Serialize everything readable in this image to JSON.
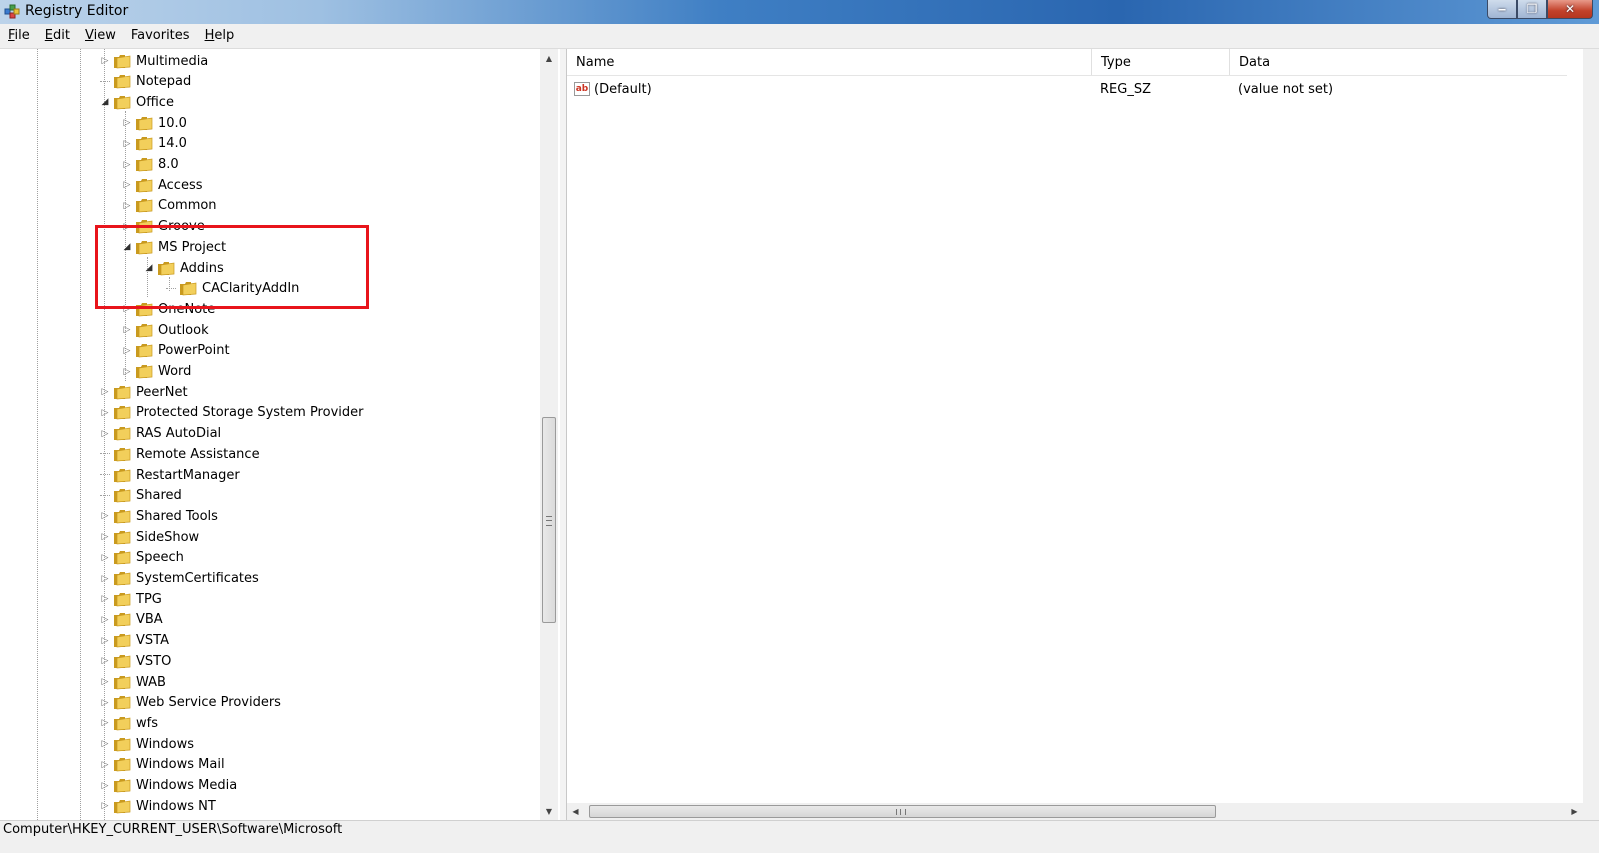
{
  "window": {
    "title": "Registry Editor",
    "controls": {
      "minimize": "‒",
      "restore": "❐",
      "close": "✕"
    }
  },
  "menu": {
    "items": [
      {
        "label": "File",
        "key": "F",
        "rest": "ile"
      },
      {
        "label": "Edit",
        "key": "E",
        "rest": "dit"
      },
      {
        "label": "View",
        "key": "V",
        "rest": "iew"
      },
      {
        "label": "Favorites",
        "key": "",
        "rest": "Favorites",
        "mid_key": "a"
      },
      {
        "label": "Help",
        "key": "H",
        "rest": "elp"
      }
    ]
  },
  "tree": {
    "nodes": [
      {
        "label": "Multimedia",
        "level": 0,
        "expander": "collapsed"
      },
      {
        "label": "Notepad",
        "level": 0,
        "expander": "none"
      },
      {
        "label": "Office",
        "level": 0,
        "expander": "expanded"
      },
      {
        "label": "10.0",
        "level": 1,
        "expander": "collapsed"
      },
      {
        "label": "14.0",
        "level": 1,
        "expander": "collapsed"
      },
      {
        "label": "8.0",
        "level": 1,
        "expander": "collapsed"
      },
      {
        "label": "Access",
        "level": 1,
        "expander": "collapsed"
      },
      {
        "label": "Common",
        "level": 1,
        "expander": "collapsed"
      },
      {
        "label": "Groove",
        "level": 1,
        "expander": "collapsed"
      },
      {
        "label": "MS Project",
        "level": 1,
        "expander": "expanded"
      },
      {
        "label": "Addins",
        "level": 2,
        "expander": "expanded"
      },
      {
        "label": "CAClarityAddIn",
        "level": 3,
        "expander": "none"
      },
      {
        "label": "OneNote",
        "level": 1,
        "expander": "collapsed"
      },
      {
        "label": "Outlook",
        "level": 1,
        "expander": "collapsed"
      },
      {
        "label": "PowerPoint",
        "level": 1,
        "expander": "collapsed"
      },
      {
        "label": "Word",
        "level": 1,
        "expander": "collapsed"
      },
      {
        "label": "PeerNet",
        "level": 0,
        "expander": "collapsed"
      },
      {
        "label": "Protected Storage System Provider",
        "level": 0,
        "expander": "collapsed"
      },
      {
        "label": "RAS AutoDial",
        "level": 0,
        "expander": "collapsed"
      },
      {
        "label": "Remote Assistance",
        "level": 0,
        "expander": "none"
      },
      {
        "label": "RestartManager",
        "level": 0,
        "expander": "none"
      },
      {
        "label": "Shared",
        "level": 0,
        "expander": "none"
      },
      {
        "label": "Shared Tools",
        "level": 0,
        "expander": "collapsed"
      },
      {
        "label": "SideShow",
        "level": 0,
        "expander": "collapsed"
      },
      {
        "label": "Speech",
        "level": 0,
        "expander": "collapsed"
      },
      {
        "label": "SystemCertificates",
        "level": 0,
        "expander": "collapsed"
      },
      {
        "label": "TPG",
        "level": 0,
        "expander": "collapsed"
      },
      {
        "label": "VBA",
        "level": 0,
        "expander": "collapsed"
      },
      {
        "label": "VSTA",
        "level": 0,
        "expander": "collapsed"
      },
      {
        "label": "VSTO",
        "level": 0,
        "expander": "collapsed"
      },
      {
        "label": "WAB",
        "level": 0,
        "expander": "collapsed"
      },
      {
        "label": "Web Service Providers",
        "level": 0,
        "expander": "collapsed"
      },
      {
        "label": "wfs",
        "level": 0,
        "expander": "collapsed"
      },
      {
        "label": "Windows",
        "level": 0,
        "expander": "collapsed"
      },
      {
        "label": "Windows Mail",
        "level": 0,
        "expander": "collapsed"
      },
      {
        "label": "Windows Media",
        "level": 0,
        "expander": "collapsed"
      },
      {
        "label": "Windows NT",
        "level": 0,
        "expander": "collapsed"
      }
    ]
  },
  "list": {
    "columns": [
      "Name",
      "Type",
      "Data"
    ],
    "rows": [
      {
        "icon": "string-value-icon",
        "icon_text": "ab",
        "name": "(Default)",
        "type": "REG_SZ",
        "data": "(value not set)"
      }
    ]
  },
  "status": {
    "path": "Computer\\HKEY_CURRENT_USER\\Software\\Microsoft"
  },
  "colors": {
    "highlight_border": "#e8141b",
    "folder_fill": "#f2cf5b",
    "folder_edge": "#c99a1f"
  }
}
